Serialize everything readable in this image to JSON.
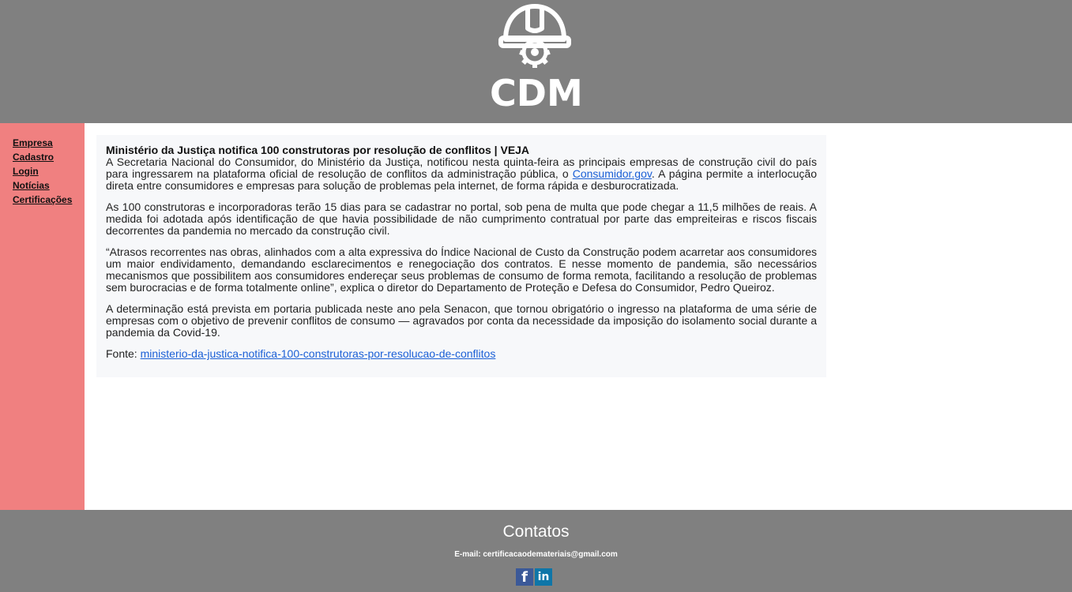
{
  "header": {
    "logo_text": "CDM",
    "logo_icon": "hardhat-gear-icon"
  },
  "sidebar": {
    "items": [
      {
        "label": "Empresa"
      },
      {
        "label": "Cadastro"
      },
      {
        "label": "Login"
      },
      {
        "label": "Notícias"
      },
      {
        "label": "Certificações"
      }
    ]
  },
  "article": {
    "title": "Ministério da Justiça notifica 100 construtoras por resolução de conflitos | VEJA",
    "p1_before": "A Secretaria Nacional do Consumidor, do Ministério da Justiça, notificou nesta quinta-feira as principais empresas de construção civil do país para ingressarem na plataforma oficial de resolução de conflitos da administração pública, o ",
    "p1_link": "Consumidor.gov",
    "p1_after": ". A página permite a interlocução direta entre consumidores e empresas para solução de problemas pela internet, de forma rápida e desburocratizada.",
    "p2": "As 100 construtoras e incorporadoras terão 15 dias para se cadastrar no portal, sob pena de multa que pode chegar a 11,5 milhões de reais. A medida foi adotada após identificação de que havia possibilidade de não cumprimento contratual por parte das empreiteiras e riscos fiscais decorrentes da pandemia no mercado da construção civil.",
    "p3": "“Atrasos recorrentes nas obras, alinhados com a alta expressiva do Índice Nacional de Custo da Construção podem acarretar aos consumidores um maior endividamento, demandando esclarecimentos e renegociação dos contratos. E nesse momento de pandemia, são necessários mecanismos que possibilitem aos consumidores endereçar seus problemas de consumo de forma remota, facilitando a resolução de problemas sem burocracias e de forma totalmente online”, explica o diretor do Departamento de Proteção e Defesa do Consumidor, Pedro Queiroz.",
    "p4": "A determinação está prevista em portaria publicada neste ano pela Senacon, que tornou obrigatório o ingresso na plataforma de uma série de empresas com o objetivo de prevenir conflitos de consumo — agravados por conta da necessidade da imposição do isolamento social durante a pandemia da Covid-19.",
    "source_label": "Fonte: ",
    "source_link": "ministerio-da-justica-notifica-100-construtoras-por-resolucao-de-conflitos"
  },
  "footer": {
    "title": "Contatos",
    "email": "E-mail: certificacaodemateriais@gmail.com",
    "social": {
      "facebook": "f",
      "linkedin": "in",
      "facebook_icon": "facebook-icon",
      "linkedin_icon": "linkedin-icon"
    }
  }
}
